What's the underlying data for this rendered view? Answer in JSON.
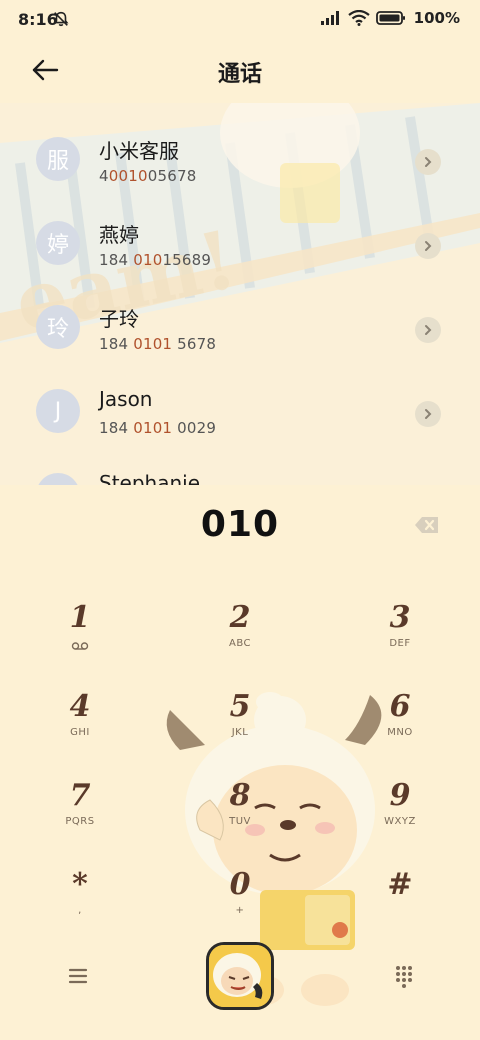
{
  "status": {
    "time": "8:16",
    "battery": "100%"
  },
  "header": {
    "title": "通话"
  },
  "contacts": [
    {
      "avatar": "服",
      "name": "小米客服",
      "number_pre": "4",
      "number_hl": "0010",
      "number_post": "05678"
    },
    {
      "avatar": "婷",
      "name": "燕婷",
      "number_pre": "184 ",
      "number_hl": "010",
      "number_post": "15689"
    },
    {
      "avatar": "玲",
      "name": "子玲",
      "number_pre": "184 ",
      "number_hl": "0101",
      "number_post": " 5678"
    },
    {
      "avatar": "J",
      "name": "Jason",
      "number_pre": "184 ",
      "number_hl": "0101",
      "number_post": " 0029"
    },
    {
      "avatar": "S",
      "name": "Stephanie",
      "number_pre": "",
      "number_hl": "",
      "number_post": ""
    }
  ],
  "dialer": {
    "dialed": "010"
  },
  "keypad": [
    {
      "digit": "1",
      "letters": ""
    },
    {
      "digit": "2",
      "letters": "ABC"
    },
    {
      "digit": "3",
      "letters": "DEF"
    },
    {
      "digit": "4",
      "letters": "GHI"
    },
    {
      "digit": "5",
      "letters": "JKL"
    },
    {
      "digit": "6",
      "letters": "MNO"
    },
    {
      "digit": "7",
      "letters": "PQRS"
    },
    {
      "digit": "8",
      "letters": "TUV"
    },
    {
      "digit": "9",
      "letters": "WXYZ"
    },
    {
      "digit": "*",
      "letters": ","
    },
    {
      "digit": "0",
      "letters": "+"
    },
    {
      "digit": "#",
      "letters": ""
    }
  ],
  "icons": {
    "bell": "bell-off-icon",
    "signal": "signal-icon",
    "wifi": "wifi-icon",
    "battery": "battery-icon",
    "back": "back-arrow-icon",
    "chevron": "chevron-right-icon",
    "backspace": "backspace-icon",
    "voicemail": "voicemail-icon",
    "menu": "menu-icon",
    "dialpad": "dialpad-icon",
    "call": "call-icon"
  },
  "colors": {
    "background": "#fdf1d4",
    "keypad_digit": "#5a3a2a",
    "number_highlight": "#b0522d",
    "avatar": "#d6dbe5"
  }
}
